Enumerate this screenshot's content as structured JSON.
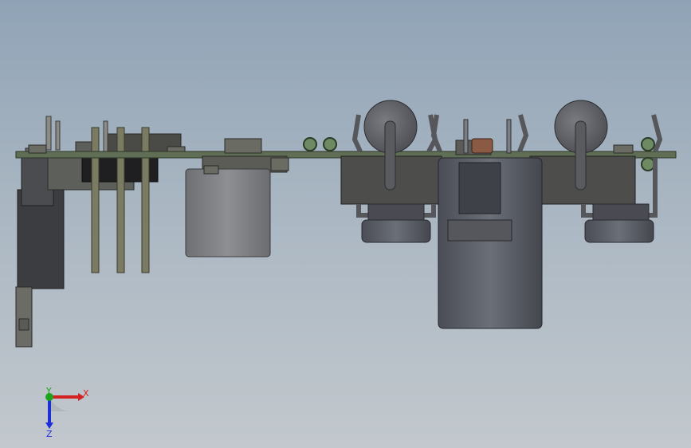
{
  "viewport": {
    "background_top": "#90a3b6",
    "background_bottom": "#c2c8cd",
    "model": "pcb-assembly-side-view"
  },
  "triad": {
    "x_label": "X",
    "y_label": "Y",
    "z_label": "Z",
    "x_color": "#d32020",
    "y_color": "#1fa31f",
    "z_color": "#1f2fd6"
  }
}
